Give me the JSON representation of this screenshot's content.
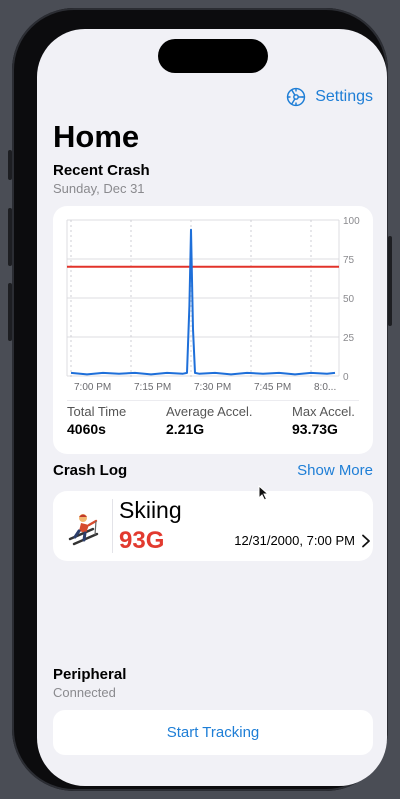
{
  "header": {
    "settings_label": "Settings",
    "settings_icon": "gear-icon",
    "title": "Home"
  },
  "recent_crash": {
    "title": "Recent Crash",
    "date": "Sunday, Dec 31",
    "stats": [
      {
        "label": "Total Time",
        "value": "4060s"
      },
      {
        "label": "Average Accel.",
        "value": "2.21G"
      },
      {
        "label": "Max Accel.",
        "value": "93.73G"
      }
    ]
  },
  "chart_data": {
    "type": "line",
    "x_tick_labels": [
      "7:00 PM",
      "7:15 PM",
      "7:30 PM",
      "7:45 PM",
      "8:0..."
    ],
    "y_ticks": [
      0,
      25,
      50,
      75,
      100
    ],
    "ylim": [
      0,
      100
    ],
    "x_range_minutes": [
      -1,
      67
    ],
    "series": [
      {
        "color": "#1e6fd9",
        "x": [
          0,
          4,
          8,
          12,
          16,
          20,
          24,
          28,
          29,
          29.6,
          30,
          30.5,
          31,
          32,
          36,
          40,
          44,
          48,
          52,
          56,
          60,
          64,
          66
        ],
        "y": [
          2,
          1,
          2,
          1.5,
          2,
          1,
          2,
          1.5,
          2,
          45,
          93.73,
          30,
          2,
          1.5,
          2,
          1,
          2,
          1.5,
          2,
          1,
          2,
          1.5,
          2
        ]
      }
    ],
    "threshold": {
      "value": 70,
      "color": "#e2332a"
    },
    "grid": true
  },
  "crash_log": {
    "title": "Crash Log",
    "show_more": "Show More",
    "entries": [
      {
        "icon": "skier-icon",
        "activity": "Skiing",
        "g_force": "93G",
        "datetime": "12/31/2000, 7:00 PM"
      }
    ]
  },
  "peripheral": {
    "title": "Peripheral",
    "status": "Connected"
  },
  "actions": {
    "start_tracking": "Start Tracking"
  },
  "colors": {
    "accent": "#1e7ed6",
    "alert": "#e23a2f",
    "background": "#f1f1f6"
  }
}
